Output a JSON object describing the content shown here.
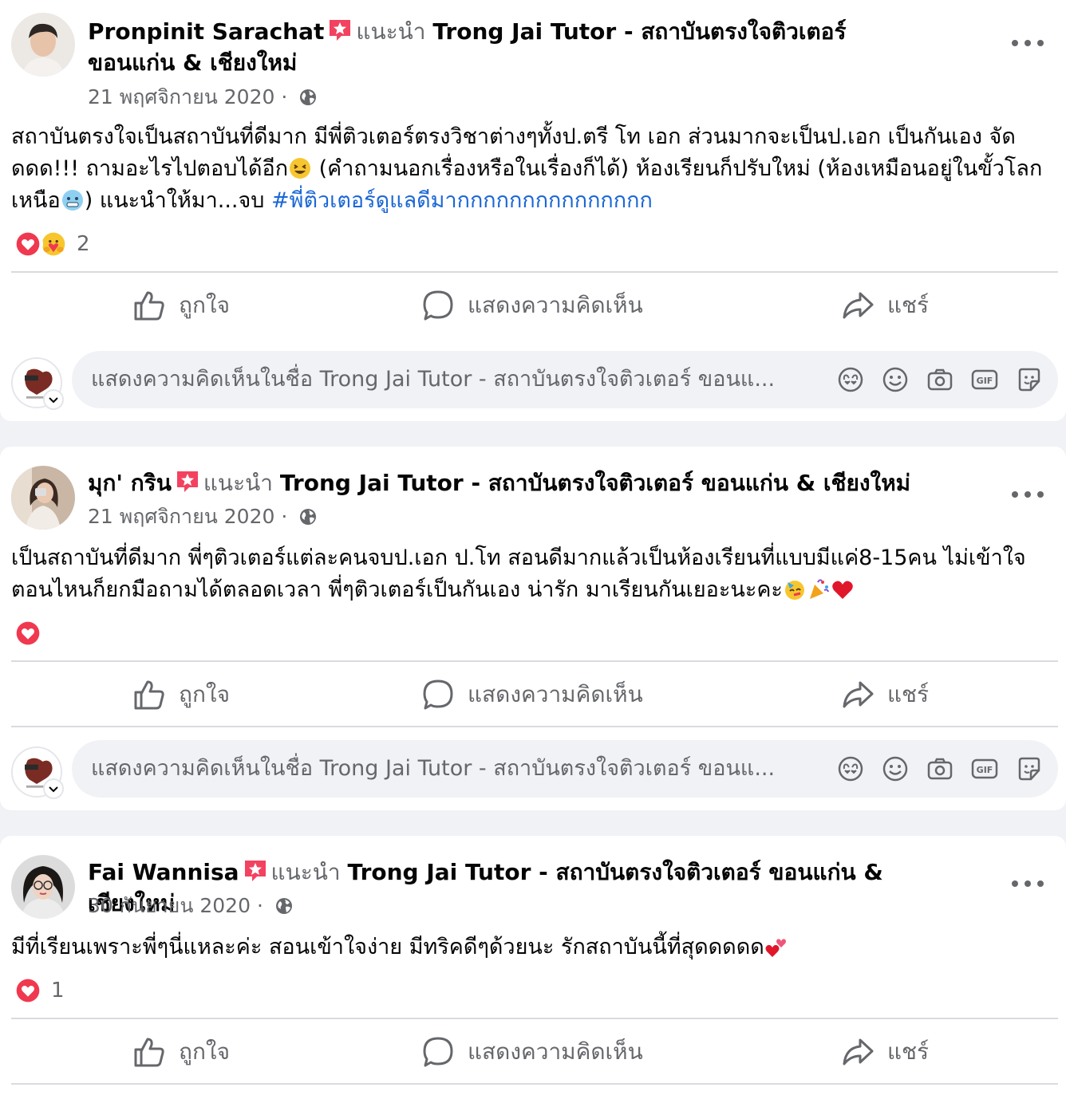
{
  "posts": [
    {
      "author": "Pronpinit Sarachat",
      "recommends": "แนะนำ",
      "page": "Trong Jai Tutor - สถาบันตรงใจติวเตอร์ ขอนแก่น & เชียงใหม่",
      "date": "21 พฤศจิกายน 2020",
      "sep": "·",
      "text": "สถาบันตรงใจเป็นสถาบันที่ดีมาก มีพี่ติวเตอร์ตรงวิชาต่างๆทั้งป.ตรี โท เอก ส่วนมากจะเป็นป.เอก เป็นกันเอง จัดดดด!!! ถามอะไรไปตอบได้อีก",
      "text2": " (คำถามนอกเรื่องหรือในเรื่องก็ได้) ห้องเรียนก็ปรับใหม่ (ห้องเหมือนอยู่ในขั้วโลกเหนือ",
      "text3": ") แนะนำให้มา...จบ ",
      "hashtag": "#พี่ติวเตอร์ดูแลดีมากกกกกกกกกกกกกกก",
      "reaction_count": "2"
    },
    {
      "author": "มุก' กริน",
      "recommends": "แนะนำ",
      "page": "Trong Jai Tutor - สถาบันตรงใจติวเตอร์ ขอนแก่น & เชียงใหม่",
      "date": "21 พฤศจิกายน 2020",
      "sep": "·",
      "text": "เป็นสถาบันที่ดีมาก พี่ๆติวเตอร์แต่ละคนจบป.เอก ป.โท สอนดีมากแล้วเป็นห้องเรียนที่แบบมีแค่8-15คน ไม่เข้าใจตอนไหนก็ยกมือถามได้ตลอดเวลา พี่ๆติวเตอร์เป็นกันเอง น่ารัก มาเรียนกันเยอะนะคะ",
      "reaction_count": ""
    },
    {
      "author": "Fai Wannisa",
      "recommends": "แนะนำ",
      "page": "Trong Jai Tutor - สถาบันตรงใจติวเตอร์ ขอนแก่น & เชียงใหม่",
      "date": "30 กันยายน 2020",
      "sep": "·",
      "text": "มีที่เรียนเพราะพี่ๆนี่แหละค่ะ สอนเข้าใจง่าย มีทริคดีๆด้วยนะ รักสถาบันนี้ที่สุดดดดด",
      "reaction_count": "1"
    }
  ],
  "actions": {
    "like": "ถูกใจ",
    "comment": "แสดงความคิดเห็น",
    "share": "แชร์"
  },
  "comment_box": {
    "placeholder": "แสดงความคิดเห็นในชื่อ Trong Jai Tutor - สถาบันตรงใจติวเตอร์ ขอนแ..."
  },
  "icons": {
    "like": "thumbs-up-icon",
    "comment": "speech-bubble-icon",
    "share": "share-arrow-icon",
    "privacy": "globe-icon",
    "recommend_badge": "recommend-star-icon",
    "more": "more-options-icon",
    "tools": [
      "avatar-sticker-icon",
      "emoji-icon",
      "camera-icon",
      "gif-icon",
      "sticker-icon"
    ]
  },
  "colors": {
    "hashtag": "#1b67d6",
    "badge": "#f3425f",
    "secondary_text": "#65676b"
  }
}
